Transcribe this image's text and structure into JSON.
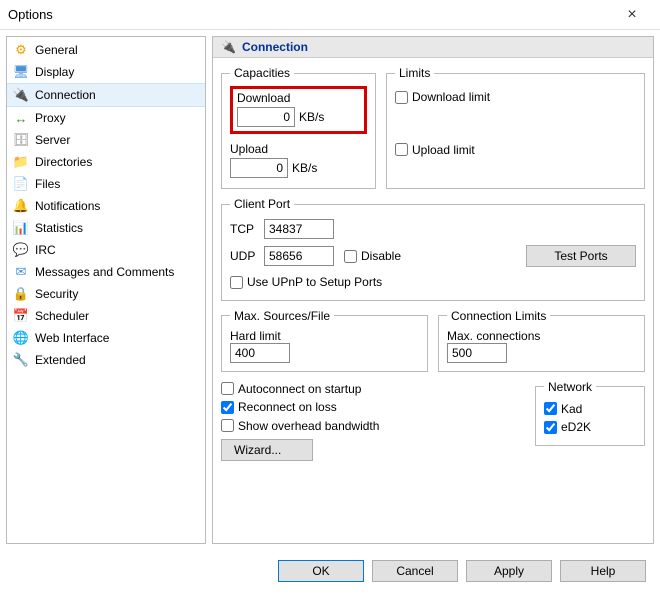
{
  "window": {
    "title": "Options"
  },
  "sidebar": {
    "items": [
      {
        "label": "General",
        "icon": "⚙",
        "color": "#f0a000"
      },
      {
        "label": "Display",
        "icon": "🖥",
        "color": "#4a90d9"
      },
      {
        "label": "Connection",
        "icon": "🔌",
        "color": "#c02020",
        "selected": true
      },
      {
        "label": "Proxy",
        "icon": "↔",
        "color": "#2aa02a"
      },
      {
        "label": "Server",
        "icon": "🗄",
        "color": "#888"
      },
      {
        "label": "Directories",
        "icon": "📁",
        "color": "#e0a030"
      },
      {
        "label": "Files",
        "icon": "📄",
        "color": "#4a90d9"
      },
      {
        "label": "Notifications",
        "icon": "🔔",
        "color": "#e0a030"
      },
      {
        "label": "Statistics",
        "icon": "📊",
        "color": "#4a90d9"
      },
      {
        "label": "IRC",
        "icon": "💬",
        "color": "#c02020"
      },
      {
        "label": "Messages and Comments",
        "icon": "✉",
        "color": "#4a90d9"
      },
      {
        "label": "Security",
        "icon": "🔒",
        "color": "#e0a030"
      },
      {
        "label": "Scheduler",
        "icon": "📅",
        "color": "#c02020"
      },
      {
        "label": "Web Interface",
        "icon": "🌐",
        "color": "#2aa02a"
      },
      {
        "label": "Extended",
        "icon": "🔧",
        "color": "#c02020"
      }
    ]
  },
  "header": {
    "title": "Connection",
    "icon": "🔌",
    "icon_color": "#c02020"
  },
  "capacities": {
    "legend": "Capacities",
    "download_label": "Download",
    "download_value": "0",
    "download_unit": "KB/s",
    "upload_label": "Upload",
    "upload_value": "0",
    "upload_unit": "KB/s"
  },
  "limits": {
    "legend": "Limits",
    "download_limit_label": "Download limit",
    "download_limit_checked": false,
    "upload_limit_label": "Upload limit",
    "upload_limit_checked": false
  },
  "client_port": {
    "legend": "Client Port",
    "tcp_label": "TCP",
    "tcp_value": "34837",
    "udp_label": "UDP",
    "udp_value": "58656",
    "disable_label": "Disable",
    "disable_checked": false,
    "test_ports_label": "Test Ports",
    "upnp_label": "Use UPnP to Setup Ports",
    "upnp_checked": false
  },
  "max_sources": {
    "legend": "Max. Sources/File",
    "hard_limit_label": "Hard limit",
    "hard_limit_value": "400"
  },
  "conn_limits": {
    "legend": "Connection Limits",
    "max_conn_label": "Max. connections",
    "max_conn_value": "500"
  },
  "misc": {
    "autoconnect_label": "Autoconnect on startup",
    "autoconnect_checked": false,
    "reconnect_label": "Reconnect on loss",
    "reconnect_checked": true,
    "overhead_label": "Show overhead bandwidth",
    "overhead_checked": false,
    "wizard_label": "Wizard..."
  },
  "network": {
    "legend": "Network",
    "kad_label": "Kad",
    "kad_checked": true,
    "ed2k_label": "eD2K",
    "ed2k_checked": true
  },
  "footer": {
    "ok": "OK",
    "cancel": "Cancel",
    "apply": "Apply",
    "help": "Help"
  }
}
